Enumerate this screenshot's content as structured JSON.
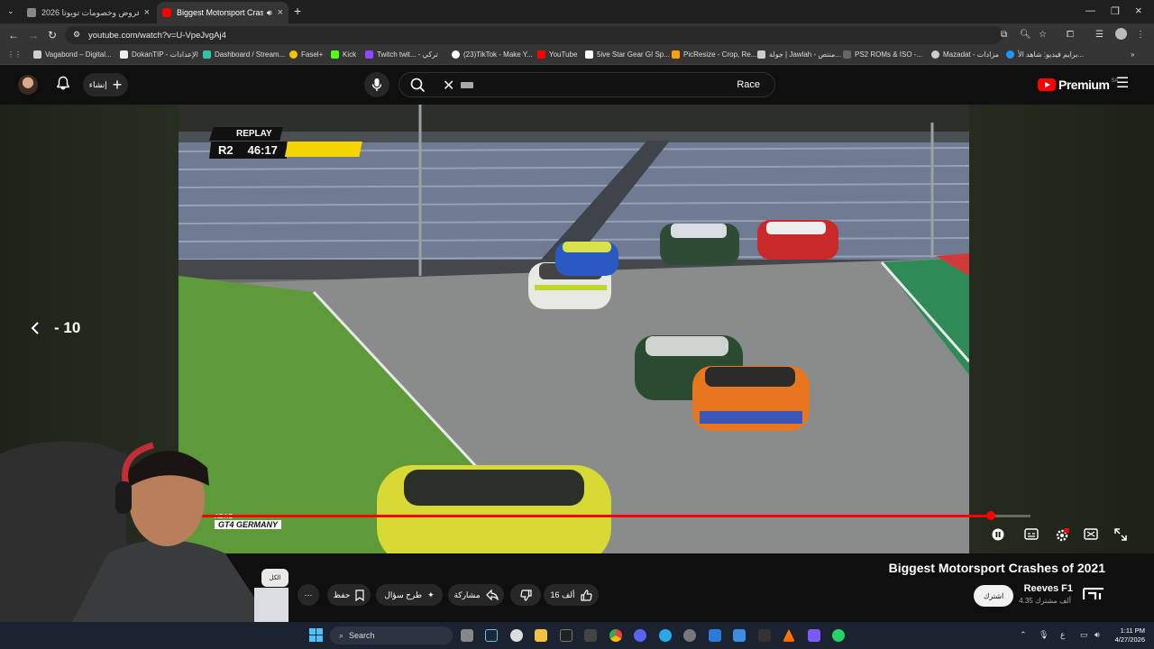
{
  "browser": {
    "tabs": [
      {
        "title": "عروض وخصومات تويوتا 2026 |...",
        "active": false
      },
      {
        "title": "Biggest Motorsport Crashe",
        "active": true
      }
    ],
    "new_tab": "+",
    "url": "youtube.com/watch?v=U-VpeJvgAj4",
    "bookmarks": [
      {
        "label": "Vagabond – Digital...",
        "color": "#cfcfcf"
      },
      {
        "label": "DokanTIP - الإعدادات",
        "color": "#eeeeee"
      },
      {
        "label": "Dashboard / Stream...",
        "color": "#2ec4a5"
      },
      {
        "label": "Fasel+",
        "color": "#f5c400"
      },
      {
        "label": "Kick",
        "color": "#53fc18"
      },
      {
        "label": "Twitch twit... - تركي",
        "color": "#9146ff"
      },
      {
        "label": "(23)TikTok - Make Y...",
        "color": "#ffffff"
      },
      {
        "label": "YouTube",
        "color": "#ff0000"
      },
      {
        "label": "5ive Star Gear GI Sp...",
        "color": "#ffffff"
      },
      {
        "label": "PicResize - Crop, Re...",
        "color": "#ffa000"
      },
      {
        "label": "جولة | Jawlah - منتص...",
        "color": "#cccccc"
      },
      {
        "label": "PS2 ROMs & ISO -...",
        "color": "#666666"
      },
      {
        "label": "Mazadat - مزادات",
        "color": "#cccccc"
      },
      {
        "label": "برايم فيديو: شاهد الأ...",
        "color": "#1a98ff"
      }
    ]
  },
  "youtube": {
    "create_label": "إنشاء",
    "search_query": "Race",
    "logo": "Premium",
    "region": "SA"
  },
  "player": {
    "overlay": {
      "replay": "REPLAY",
      "lap": "R2",
      "time": "46:17",
      "series_top": "ADAC",
      "series_bottom": "GT4 GERMANY"
    },
    "seek_label": "- 10",
    "progress": 0.953
  },
  "video": {
    "title": "Biggest Motorsport Crashes of 2021",
    "channel": "Reeves F1",
    "subscribers": "4.35 ألف مشترك",
    "subscribe_label": "اشترك",
    "likes": "16 ألف",
    "share_label": "مشاركة",
    "ask_label": "طرح سؤال",
    "save_label": "حفظ",
    "chip_label": "الكل"
  },
  "taskbar": {
    "search": "Search",
    "time": "1:11 PM",
    "date": "4/27/2026",
    "lang": "ع"
  },
  "colors": {
    "accent": "#ff0000",
    "overlay_yellow": "#f5d400"
  }
}
